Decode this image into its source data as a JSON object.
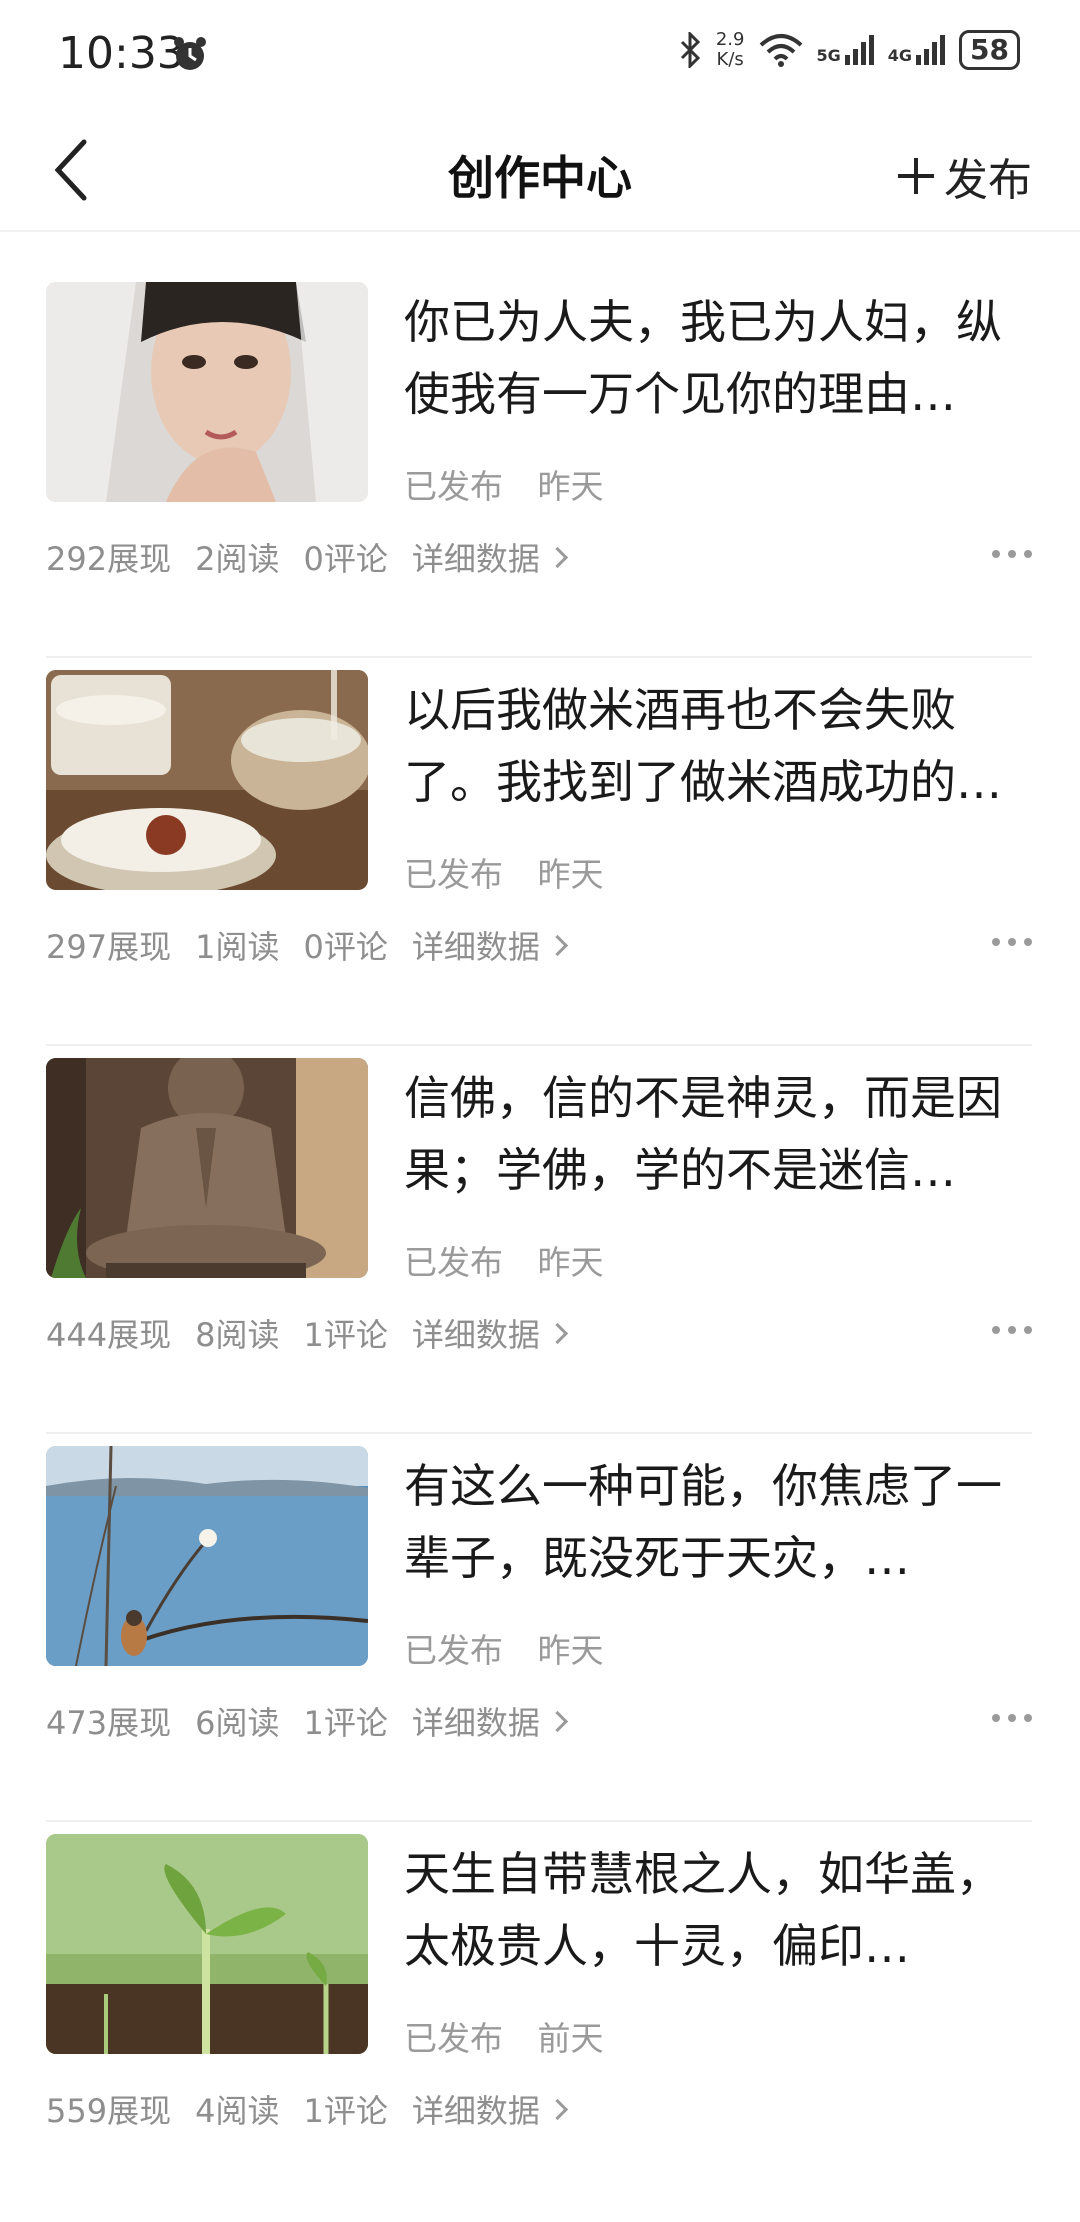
{
  "status_bar": {
    "time": "10:33",
    "net_speed_value": "2.9",
    "net_speed_unit": "K/s",
    "signal_5g": "5G",
    "signal_4g": "4G",
    "battery": "58"
  },
  "header": {
    "title": "创作中心",
    "publish_label": "发布"
  },
  "articles": [
    {
      "title": "你已为人夫，我已为人妇，纵使我有一万个见你的理由…",
      "status": "已发布",
      "date": "昨天",
      "views": "292展现",
      "reads": "2阅读",
      "comments": "0评论",
      "detail": "详细数据",
      "thumb": "veiled-woman"
    },
    {
      "title": "以后我做米酒再也不会失败了。我找到了做米酒成功的方法…",
      "status": "已发布",
      "date": "昨天",
      "views": "297展现",
      "reads": "1阅读",
      "comments": "0评论",
      "detail": "详细数据",
      "thumb": "rice-wine"
    },
    {
      "title": "信佛，信的不是神灵，而是因果；学佛，学的不是迷信…",
      "status": "已发布",
      "date": "昨天",
      "views": "444展现",
      "reads": "8阅读",
      "comments": "1评论",
      "detail": "详细数据",
      "thumb": "buddha-statue"
    },
    {
      "title": "有这么一种可能，你焦虑了一辈子，既没死于天灾，…",
      "status": "已发布",
      "date": "昨天",
      "views": "473展现",
      "reads": "6阅读",
      "comments": "1评论",
      "detail": "详细数据",
      "thumb": "bird-on-branch"
    },
    {
      "title": "天生自带慧根之人，如华盖，太极贵人，十灵，偏印…",
      "status": "已发布",
      "date": "前天",
      "views": "559展现",
      "reads": "4阅读",
      "comments": "1评论",
      "detail": "详细数据",
      "thumb": "seedling"
    }
  ]
}
